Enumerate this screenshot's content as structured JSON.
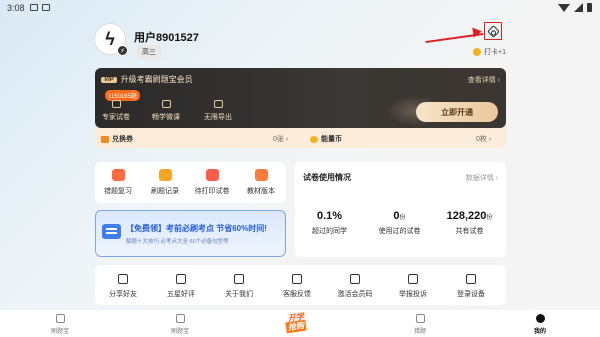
{
  "status_bar": {
    "time": "3:08"
  },
  "profile": {
    "username": "用户8901527",
    "grade": "高三",
    "checkin": "打卡+1"
  },
  "vip": {
    "title": "升级考霸刷题宝会员",
    "tag": "VIP",
    "detail": "查看详情",
    "badge": "1150165题",
    "perks": [
      "专家试卷",
      "畅学微课",
      "无限导出"
    ],
    "button": "立即开通"
  },
  "coupons": {
    "exchange_label": "兑换券",
    "exchange_val": "0张",
    "energy_label": "能量币",
    "energy_val": "0枚"
  },
  "tools": [
    "错题复习",
    "刷题记录",
    "待打印试卷",
    "教材版本"
  ],
  "promo": {
    "title": "【免费领】考前必刷考点 节省60%时间!",
    "subtitle": "解题十大技巧 必考点大全 60个必备句型等"
  },
  "stats": {
    "title": "试卷使用情况",
    "detail": "数据详情",
    "items": [
      {
        "num": "0.1%",
        "unit": "",
        "label": "超过的同学"
      },
      {
        "num": "0",
        "unit": "份",
        "label": "使用过的试卷"
      },
      {
        "num": "128,220",
        "unit": "份",
        "label": "共有试卷"
      }
    ]
  },
  "actions": [
    "分享好友",
    "五星好评",
    "关于我们",
    "客服反馈",
    "激活会员码",
    "举报投诉",
    "登录设备"
  ],
  "tabs": [
    "刷题宝",
    "刷题宝",
    "错题",
    "我的"
  ],
  "center_tab": {
    "line1": "开学",
    "line2": "抢购"
  }
}
